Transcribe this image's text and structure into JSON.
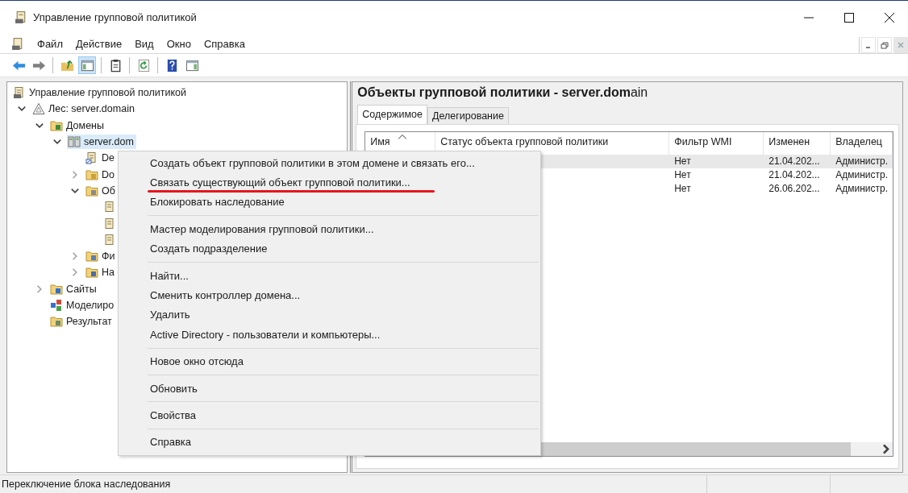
{
  "window": {
    "title": "Управление групповой политикой"
  },
  "menu_bar": [
    "Файл",
    "Действие",
    "Вид",
    "Окно",
    "Справка"
  ],
  "toolbar": [
    [
      {
        "kind": "back",
        "pressed": false
      },
      {
        "kind": "forward",
        "pressed": false
      }
    ],
    [
      {
        "kind": "up",
        "pressed": false
      },
      {
        "kind": "tree-toggle",
        "pressed": true
      }
    ],
    [
      {
        "kind": "export",
        "pressed": false
      }
    ],
    [
      {
        "kind": "refresh",
        "pressed": false
      }
    ],
    [
      {
        "kind": "help",
        "pressed": false
      },
      {
        "kind": "action-pane",
        "pressed": false
      }
    ]
  ],
  "tree": [
    {
      "label": "Управление групповой политикой",
      "kind": "console",
      "selected": false,
      "children": [
        {
          "label": "Лес: server.domain",
          "kind": "forest",
          "selected": false,
          "expanded": true,
          "children": [
            {
              "label": "Домены",
              "kind": "domains",
              "selected": false,
              "expanded": true,
              "children": [
                {
                  "label": "server.dom",
                  "kind": "domain",
                  "selected": true,
                  "expanded": true,
                  "children": [
                    {
                      "label": "De",
                      "kind": "gpo-link",
                      "selected": false
                    },
                    {
                      "label": "Do",
                      "kind": "folder",
                      "selected": false,
                      "expanded": false
                    },
                    {
                      "label": "Об",
                      "kind": "gpo-folder",
                      "selected": false,
                      "expanded": true,
                      "children": [
                        {
                          "kind": "gpo",
                          "selected": false
                        },
                        {
                          "kind": "gpo",
                          "selected": false
                        },
                        {
                          "kind": "gpo",
                          "selected": false
                        }
                      ]
                    },
                    {
                      "label": "Фи",
                      "kind": "filter",
                      "selected": false,
                      "expanded": false
                    },
                    {
                      "label": "На",
                      "kind": "starter",
                      "selected": false,
                      "expanded": false
                    }
                  ]
                }
              ]
            },
            {
              "label": "Сайты",
              "kind": "sites",
              "selected": false,
              "expanded": false
            },
            {
              "label": "Моделиро",
              "kind": "modeling",
              "selected": false
            },
            {
              "label": "Результат",
              "kind": "results",
              "selected": false
            }
          ]
        }
      ]
    }
  ],
  "details": {
    "heading": "**Объекты групповой политики - server.dom**ain",
    "tabs": [
      {
        "label": "Содержимое",
        "selected": true
      },
      {
        "label": "Делегирование",
        "selected": false
      }
    ],
    "columns": [
      "Имя",
      "Статус объекта групповой политики",
      "Фильтр WMI",
      "Изменен",
      "Владелец"
    ],
    "rows": [
      {
        "selected": true,
        "wmi_filter": "Нет",
        "modified": "21.04.202...",
        "owner": "Администр."
      },
      {
        "selected": false,
        "wmi_filter": "Нет",
        "modified": "21.04.202...",
        "owner": "Администр."
      },
      {
        "selected": false,
        "wmi_filter": "Нет",
        "modified": "26.06.202...",
        "owner": "Администр."
      }
    ]
  },
  "context_menu": {
    "groups": [
      [
        {
          "label": "Создать объект групповой политики в этом домене и связать его...",
          "annotated": false
        },
        {
          "label": "Связать существующий объект групповой политики...",
          "annotated": true
        },
        {
          "label": "Блокировать наследование",
          "annotated": false
        }
      ],
      [
        {
          "label": "Мастер моделирования групповой политики...",
          "annotated": false
        },
        {
          "label": "Создать подразделение",
          "annotated": false
        }
      ],
      [
        {
          "label": "Найти...",
          "annotated": false
        },
        {
          "label": "Сменить контроллер домена...",
          "annotated": false
        },
        {
          "label": "Удалить",
          "annotated": false
        },
        {
          "label": "Active Directory - пользователи и компьютеры...",
          "annotated": false
        }
      ],
      [
        {
          "label": "Новое окно отсюда",
          "annotated": false
        }
      ],
      [
        {
          "label": "Обновить",
          "annotated": false
        }
      ],
      [
        {
          "label": "Свойства",
          "annotated": false
        }
      ],
      [
        {
          "label": "Справка",
          "annotated": false
        }
      ]
    ]
  },
  "status_bar": "Переключение блока наследования"
}
